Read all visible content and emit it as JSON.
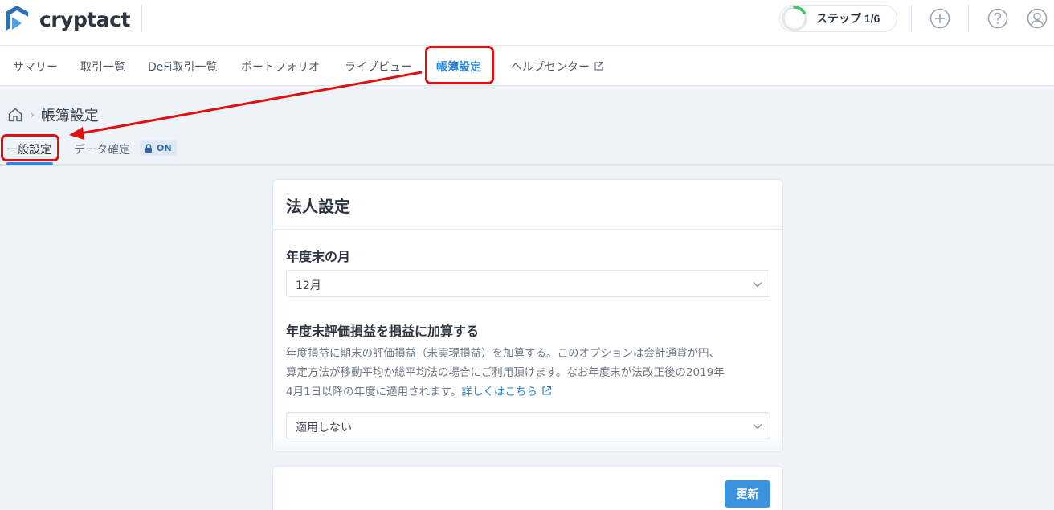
{
  "header": {
    "brand": "cryptact",
    "step_label": "ステップ 1/6",
    "step_progress": 0.1667,
    "icons": [
      "add-icon",
      "help-icon",
      "user-icon"
    ]
  },
  "nav": {
    "items": [
      {
        "label": "サマリー"
      },
      {
        "label": "取引一覧"
      },
      {
        "label": "DeFi取引一覧"
      },
      {
        "label": "ポートフォリオ"
      },
      {
        "label": "ライブビュー"
      },
      {
        "label": "帳簿設定",
        "active": true
      },
      {
        "label": "ヘルプセンター",
        "external": true
      }
    ]
  },
  "breadcrumb": {
    "home_icon": "home-icon",
    "title": "帳簿設定"
  },
  "subtabs": {
    "general": "一般設定",
    "data_confirm": "データ確定",
    "badge": "ON"
  },
  "card": {
    "title": "法人設定",
    "fiscal_month": {
      "label": "年度末の月",
      "value": "12月"
    },
    "unrealized": {
      "label": "年度末評価損益を損益に加算する",
      "desc_line1": "年度損益に期末の評価損益（未実現損益）を加算する。このオプションは会計通貨が円、",
      "desc_line2": "算定方法が移動平均か総平均法の場合にご利用頂けます。なお年度末が法改正後の2019年",
      "desc_line3": "4月1日以降の年度に適用されます。",
      "link": "詳しくはこちら",
      "value": "適用しない"
    }
  },
  "footer": {
    "update_label": "更新"
  },
  "colors": {
    "accent": "#2b84d6",
    "button": "#3d92e0",
    "annotation": "#e01010",
    "background": "#eef2f9"
  }
}
